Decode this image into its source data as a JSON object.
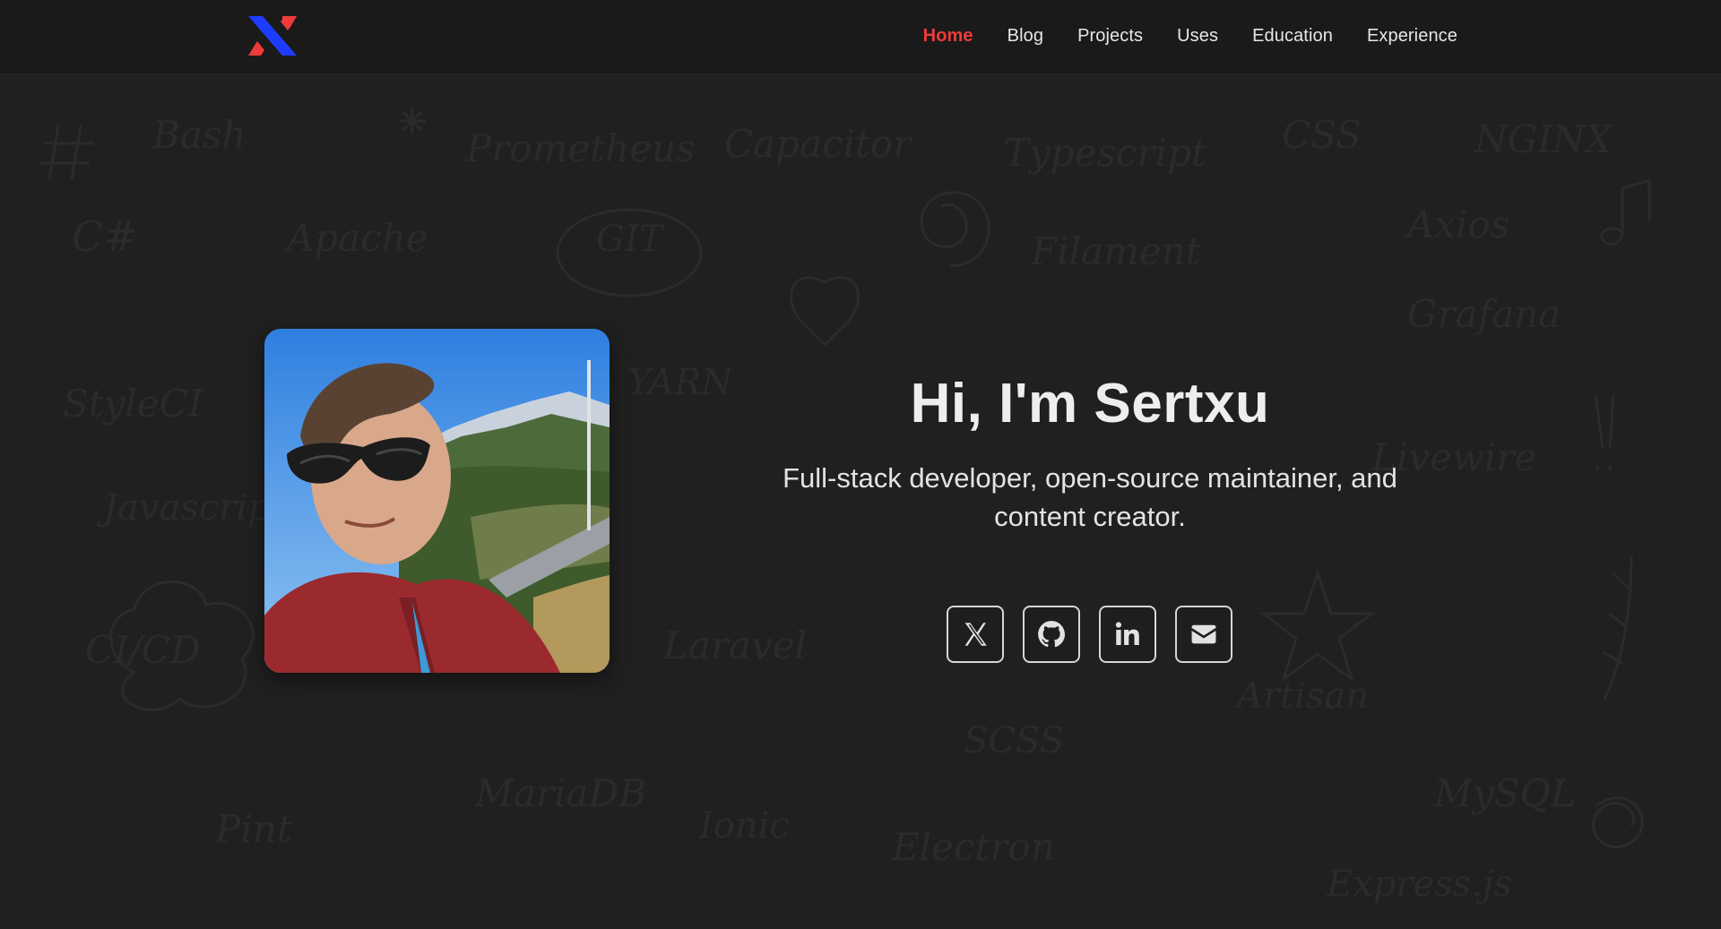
{
  "nav": {
    "logo_alt": "Sertxu logo",
    "items": [
      {
        "label": "Home",
        "active": true
      },
      {
        "label": "Blog",
        "active": false
      },
      {
        "label": "Projects",
        "active": false
      },
      {
        "label": "Uses",
        "active": false
      },
      {
        "label": "Education",
        "active": false
      },
      {
        "label": "Experience",
        "active": false
      }
    ]
  },
  "hero": {
    "title": "Hi, I'm Sertxu",
    "subtitle": "Full-stack developer, open-source maintainer, and content creator.",
    "socials": [
      {
        "icon": "x-icon"
      },
      {
        "icon": "github-icon"
      },
      {
        "icon": "linkedin-icon"
      },
      {
        "icon": "mail-icon"
      }
    ]
  },
  "background_words": [
    "Bash",
    "Prometheus",
    "Capacitor",
    "Typescript",
    "CSS",
    "NGINX",
    "C#",
    "Apache",
    "GIT",
    "Filament",
    "Axios",
    "Grafana",
    "StyleCI",
    "YARN",
    "Livewire",
    "Javascript",
    "CI/CD",
    "Laravel",
    "Artisan",
    "SCSS",
    "MariaDB",
    "Pint",
    "Ionic",
    "Electron",
    "MySQL",
    "Express.js"
  ],
  "colors": {
    "accent": "#ef3b3b",
    "logo_blue": "#1d3cff",
    "logo_red": "#ef3b3b",
    "background": "#202020",
    "navbar": "#1a1a1a"
  }
}
